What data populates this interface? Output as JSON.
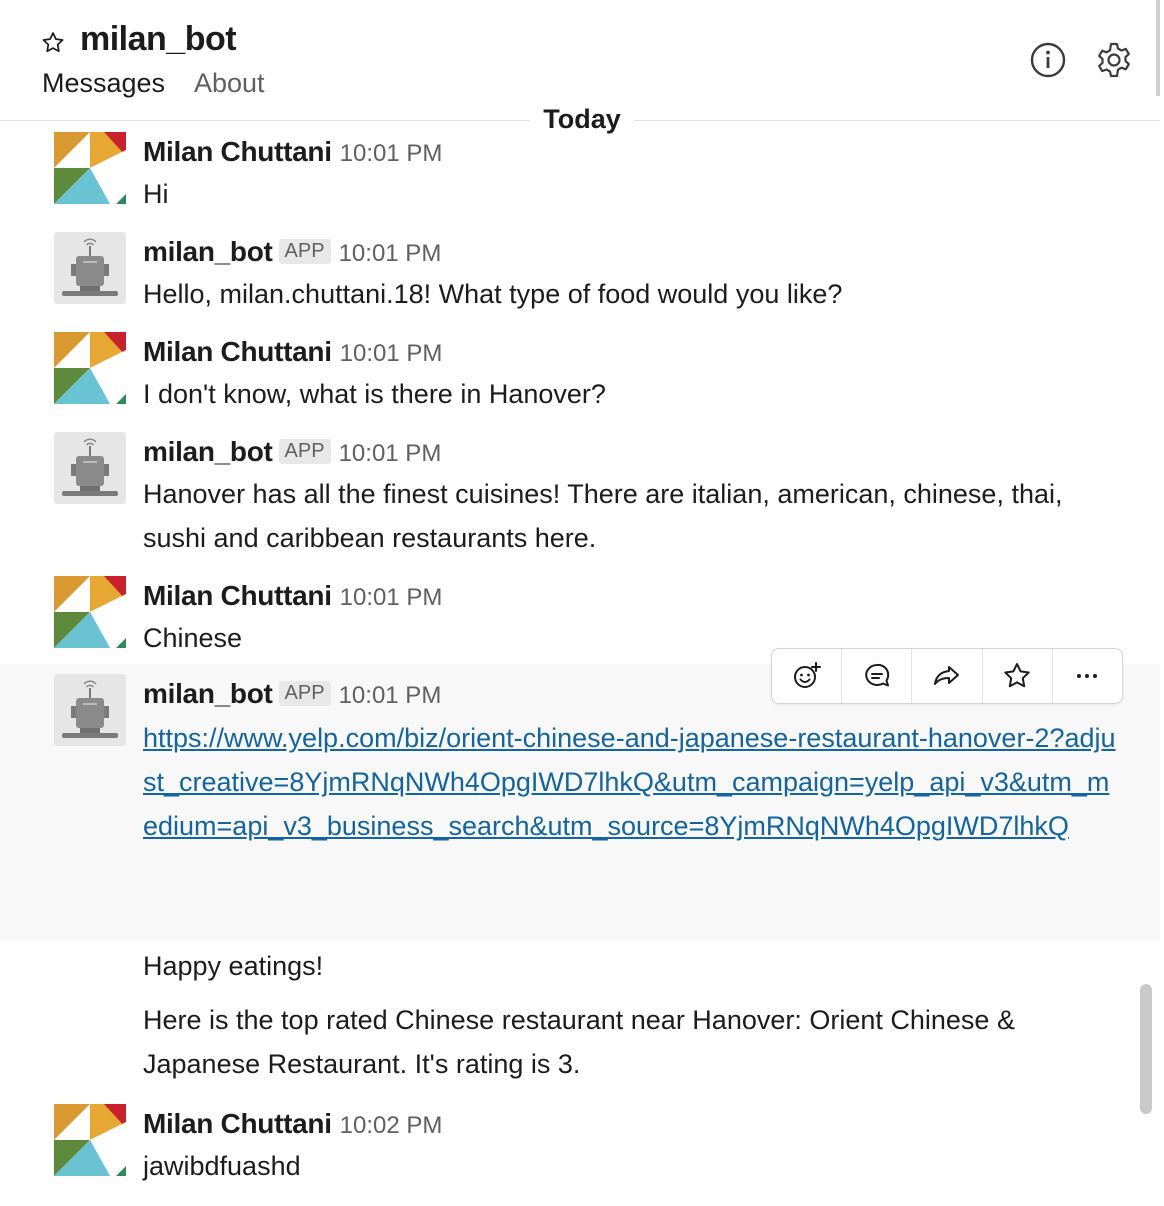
{
  "header": {
    "channel": "milan_bot",
    "tabs": [
      {
        "label": "Messages"
      },
      {
        "label": "About"
      }
    ]
  },
  "divider": {
    "label": "Today"
  },
  "messages": [
    {
      "author": "Milan Chuttani",
      "time": "10:01 PM",
      "text": "Hi"
    },
    {
      "author": "milan_bot",
      "badge": "APP",
      "time": "10:01 PM",
      "text": "Hello, milan.chuttani.18! What type of food would you like?"
    },
    {
      "author": "Milan Chuttani",
      "time": "10:01 PM",
      "text": "I don't know, what is there in Hanover?"
    },
    {
      "author": "milan_bot",
      "badge": "APP",
      "time": "10:01 PM",
      "text": "Hanover has all the finest cuisines! There are italian, american, chinese, thai, sushi and caribbean restaurants here."
    },
    {
      "author": "Milan Chuttani",
      "time": "10:01 PM",
      "text": "Chinese"
    },
    {
      "author": "milan_bot",
      "badge": "APP",
      "time": "10:01 PM",
      "link": "https://www.yelp.com/biz/orient-chinese-and-japanese-restaurant-hanover-2?adjust_creative=8YjmRNqNWh4OpgIWD7lhkQ&utm_campaign=yelp_api_v3&utm_medium=api_v3_business_search&utm_source=8YjmRNqNWh4OpgIWD7lhkQ",
      "followups": [
        "Happy eatings!",
        "Here is the top rated Chinese restaurant near Hanover: Orient Chinese & Japanese Restaurant. It's rating is 3."
      ]
    },
    {
      "author": "Milan Chuttani",
      "time": "10:02 PM",
      "text": "jawibdfuashd"
    }
  ],
  "colors": {
    "link": "#1264a3",
    "hover_bg": "#f8f8f8",
    "muted": "#616061"
  },
  "icons": {
    "header": [
      "star-icon",
      "info-icon",
      "gear-icon"
    ],
    "toolbar": [
      "add-reaction-icon",
      "reply-thread-icon",
      "share-icon",
      "star-icon",
      "more-icon"
    ]
  }
}
